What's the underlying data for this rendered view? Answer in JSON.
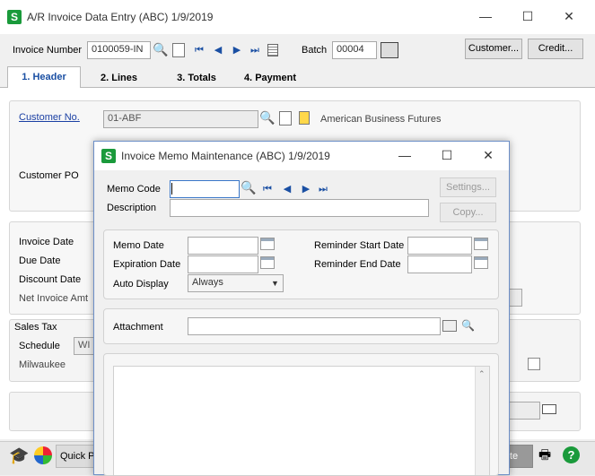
{
  "window": {
    "title": "A/R Invoice Data Entry (ABC) 1/9/2019",
    "minimize": "—",
    "maximize": "☐",
    "close": "✕"
  },
  "toolbar": {
    "invoice_number_label": "Invoice Number",
    "invoice_number_value": "0100059-IN",
    "batch_label": "Batch",
    "batch_value": "00004",
    "customer_button": "Customer...",
    "credit_button": "Credit..."
  },
  "tabs": [
    {
      "num": "1.",
      "label": "Header"
    },
    {
      "num": "2.",
      "label": "Lines"
    },
    {
      "num": "3.",
      "label": "Totals"
    },
    {
      "num": "4.",
      "label": "Payment"
    }
  ],
  "header": {
    "customer_no_label": "Customer No.",
    "customer_no_value": "01-ABF",
    "customer_name": "American Business Futures",
    "customer_po_label": "Customer PO",
    "invoice_date_label": "Invoice Date",
    "due_date_label": "Due Date",
    "discount_date_label": "Discount Date",
    "net_invoice_amt_label": "Net Invoice Amt",
    "sales_tax_label": "Sales Tax",
    "schedule_label": "Schedule",
    "schedule_value": "WI M",
    "schedule_desc": "Milwaukee"
  },
  "bottom_bar": {
    "quick_label": "Quick P",
    "right_label": "te"
  },
  "memo": {
    "title": "Invoice Memo Maintenance (ABC) 1/9/2019",
    "minimize": "—",
    "maximize": "☐",
    "close": "✕",
    "memo_code_label": "Memo Code",
    "memo_code_value": "",
    "description_label": "Description",
    "description_value": "",
    "settings_button": "Settings...",
    "copy_button": "Copy...",
    "memo_date_label": "Memo Date",
    "expiration_date_label": "Expiration Date",
    "auto_display_label": "Auto Display",
    "auto_display_value": "Always",
    "reminder_start_label": "Reminder Start Date",
    "reminder_end_label": "Reminder End Date",
    "attachment_label": "Attachment",
    "attachment_value": ""
  },
  "colors": {
    "accent": "#1a4fa3",
    "logo": "#1a9a3b"
  }
}
